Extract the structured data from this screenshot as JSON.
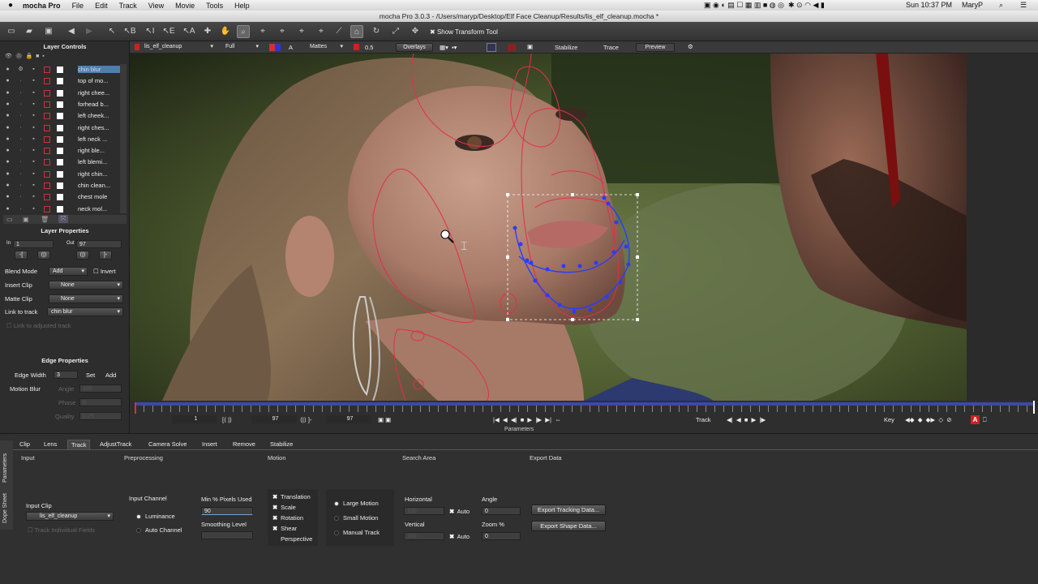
{
  "menubar": {
    "apple": "",
    "app_name": "mocha Pro",
    "items": [
      "File",
      "Edit",
      "Track",
      "View",
      "Movie",
      "Tools",
      "Help"
    ],
    "clock": "Sun 10:37 PM",
    "user": "MaryP"
  },
  "window": {
    "title": "mocha Pro 3.0.3 - /Users/maryp/Desktop/Elf Face Cleanup/Results/lis_elf_cleanup.mocha *"
  },
  "toolbar": {
    "show_transform_label": "Show Transform Tool"
  },
  "viewer_toolbar": {
    "clip": "lis_elf_cleanup",
    "resolution": "Full",
    "a_label": "A",
    "mattes": "Mattes",
    "opacity": "0.5",
    "overlays": "Overlays",
    "stabilize": "Stabilize",
    "trace": "Trace",
    "preview": "Preview"
  },
  "layer_controls": {
    "title": "Layer Controls",
    "layers": [
      {
        "name": "chin blur",
        "selected": true
      },
      {
        "name": "top of mo...",
        "selected": false
      },
      {
        "name": "right chee...",
        "selected": false
      },
      {
        "name": "forhead b...",
        "selected": false
      },
      {
        "name": "left cheek...",
        "selected": false
      },
      {
        "name": "right ches...",
        "selected": false
      },
      {
        "name": "left neck ...",
        "selected": false
      },
      {
        "name": "right ble...",
        "selected": false
      },
      {
        "name": "left blemi...",
        "selected": false
      },
      {
        "name": "right chin...",
        "selected": false
      },
      {
        "name": "chin clean...",
        "selected": false
      },
      {
        "name": "chest mole",
        "selected": false
      },
      {
        "name": "neck mol...",
        "selected": false
      }
    ]
  },
  "layer_properties": {
    "title": "Layer Properties",
    "in_label": "In",
    "in_value": "1",
    "out_label": "Out",
    "out_value": "97",
    "blend_mode_label": "Blend Mode",
    "blend_mode": "Add",
    "invert_label": "Invert",
    "insert_clip_label": "Insert Clip",
    "insert_clip": "None",
    "matte_clip_label": "Matte Clip",
    "matte_clip": "None",
    "link_to_track_label": "Link to track",
    "link_to_track": "chin blur",
    "link_adjusted_label": "Link to adjusted track"
  },
  "edge_properties": {
    "title": "Edge Properties",
    "edge_width_label": "Edge Width",
    "edge_width": "3",
    "set_label": "Set",
    "add_label": "Add",
    "motion_blur_label": "Motion Blur",
    "angle_label": "Angle",
    "angle_value": "180",
    "phase_label": "Phase",
    "phase_value": "0",
    "quality_label": "Quality",
    "quality_value": "0.25"
  },
  "timeline": {
    "start": "1",
    "current": "97",
    "end": "97",
    "track_label": "Track",
    "key_label": "Key",
    "parameters_label": "Parameters",
    "key_a": "A"
  },
  "params": {
    "tabs": [
      "Clip",
      "Lens",
      "Track",
      "AdjustTrack",
      "Camera Solve",
      "Insert",
      "Remove",
      "Stabilize"
    ],
    "active_tab": "Track",
    "side_tabs": [
      "Parameters",
      "Dope Sheet"
    ],
    "sections": {
      "input": "Input",
      "preprocessing": "Preprocessing",
      "motion": "Motion",
      "search_area": "Search Area",
      "export_data": "Export Data"
    },
    "input_clip_label": "Input Clip",
    "input_clip": "lis_elf_cleanup",
    "track_individual_fields": "Track Individual Fields",
    "input_channel_label": "Input Channel",
    "luminance": "Luminance",
    "auto_channel": "Auto Channel",
    "min_pixels_label": "Min % Pixels Used",
    "min_pixels_value": "90",
    "smoothing_label": "Smoothing Level",
    "motion_options": [
      "Translation",
      "Scale",
      "Rotation",
      "Shear",
      "Perspective"
    ],
    "motion_checked": [
      true,
      true,
      true,
      true,
      false
    ],
    "motion_types": [
      "Large Motion",
      "Small Motion",
      "Manual Track"
    ],
    "horizontal_label": "Horizontal",
    "vertical_label": "Vertical",
    "horizontal_value": "100",
    "vertical_value": "100",
    "auto_label": "Auto",
    "angle_label": "Angle",
    "angle_value": "0",
    "zoom_label": "Zoom %",
    "zoom_value": "0",
    "export_tracking": "Export Tracking Data...",
    "export_shape": "Export Shape Data..."
  }
}
